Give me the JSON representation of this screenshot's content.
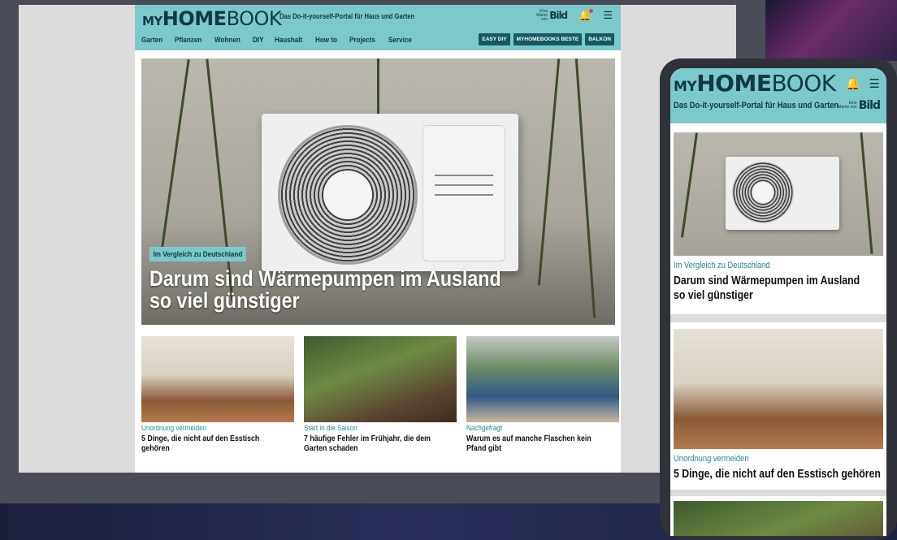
{
  "desktop": {
    "logo": {
      "my": "MY",
      "home": "HOME",
      "book": "BOOK"
    },
    "tagline": "Das Do-it-yourself-Portal für Haus und Garten",
    "bild_badge": {
      "small": "Eine Marke von",
      "name": "Bild"
    },
    "nav": [
      "Garten",
      "Pflanzen",
      "Wohnen",
      "DIY",
      "Haushalt",
      "How to",
      "Projects",
      "Service"
    ],
    "pills": [
      "EASY DIY",
      "MYHOMEBOOKS BESTE",
      "BALKON"
    ],
    "hero": {
      "category": "Im Vergleich zu Deutschland",
      "title": "Darum sind Wärmepumpen im Ausland so viel günstiger"
    },
    "cards": [
      {
        "category": "Unordnung vermeiden",
        "title": "5 Dinge, die nicht auf den Esstisch gehören"
      },
      {
        "category": "Start in die Saison",
        "title": "7 häufige Fehler im Frühjahr, die dem Garten schaden"
      },
      {
        "category": "Nachgefragt",
        "title": "Warum es auf manche Flaschen kein Pfand gibt"
      }
    ]
  },
  "mobile": {
    "logo": {
      "my": "MY",
      "home": "HOME",
      "book": "BOOK"
    },
    "tagline": "Das Do-it-yourself-Portal für Haus und Garten",
    "bild_badge": {
      "small": "Eine Marke von",
      "name": "Bild"
    },
    "article1": {
      "category": "Im Vergleich zu Deutschland",
      "title": "Darum sind Wärmepumpen im Ausland so viel günstiger"
    },
    "article2": {
      "category": "Unordnung vermeiden",
      "title": "5 Dinge, die nicht auf den Esstisch gehören"
    }
  },
  "icons": {
    "bell": "bell-icon",
    "menu": "hamburger-menu-icon"
  },
  "colors": {
    "header": "#7cc9cc",
    "pill": "#145c61",
    "category_text": "#1f8a8e",
    "brand_dark": "#0f3a40"
  }
}
